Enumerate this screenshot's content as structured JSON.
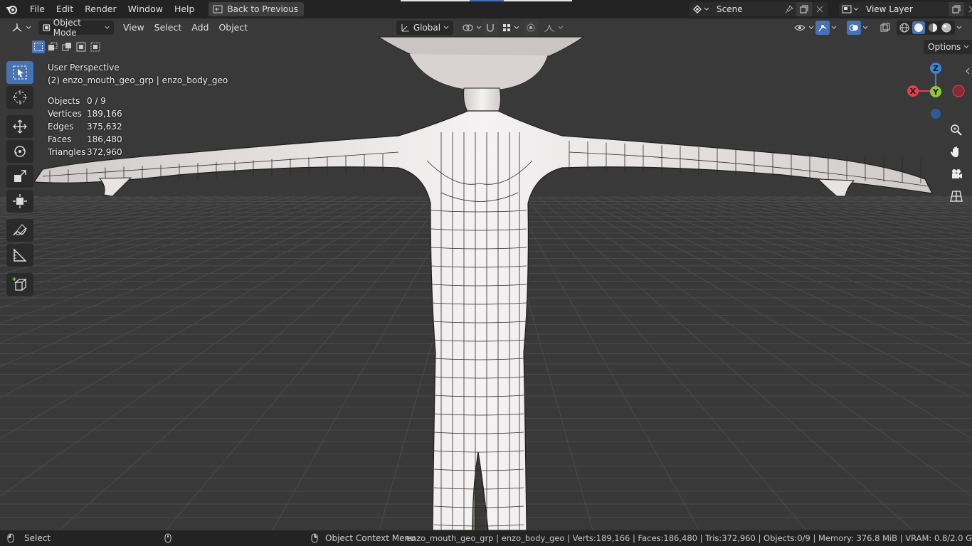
{
  "menu": {
    "file": "File",
    "edit": "Edit",
    "render": "Render",
    "window": "Window",
    "help": "Help",
    "back_to_previous": "Back to Previous"
  },
  "scene": {
    "name": "Scene"
  },
  "view_layer": {
    "name": "View Layer"
  },
  "header": {
    "mode": "Object Mode",
    "view": "View",
    "select": "Select",
    "add": "Add",
    "object": "Object",
    "transform_orientation": "Global",
    "options": "Options"
  },
  "overlay": {
    "perspective": "User Perspective",
    "active_object": "(2) enzo_mouth_geo_grp | enzo_body_geo",
    "stats": [
      {
        "label": "Objects",
        "value": "0 / 9"
      },
      {
        "label": "Vertices",
        "value": "189,166"
      },
      {
        "label": "Edges",
        "value": "375,632"
      },
      {
        "label": "Faces",
        "value": "186,480"
      },
      {
        "label": "Triangles",
        "value": "372,960"
      }
    ]
  },
  "gizmo": {
    "x": "X",
    "y": "Y",
    "z": "Z"
  },
  "statusbar": {
    "select": "Select",
    "context_menu": "Object Context Menu",
    "info": "enzo_mouth_geo_grp | enzo_body_geo | Verts:189,166 | Faces:186,480 | Tris:372,960 | Objects:0/9 | Memory: 376.8 MiB | VRAM: 0.8/2.0 G"
  },
  "colors": {
    "accent": "#4772b3",
    "axis_x": "#e2404f",
    "axis_y": "#8cc63f",
    "axis_z": "#3f82d6",
    "viewport_bg": "#393939",
    "mesh": "#f0eeee"
  }
}
